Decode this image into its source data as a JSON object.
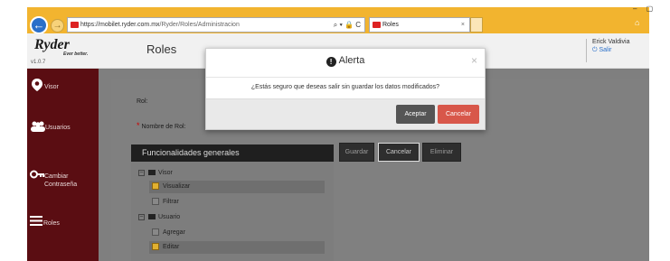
{
  "browser": {
    "url_host": "https://mobilet.ryder.com.mx",
    "url_path": "/Ryder/Roles/Administracion",
    "address_icons": "⌕ ▾ 🔒 C",
    "tab_title": "Roles",
    "tab_close": "×",
    "window_controls": "– ▢"
  },
  "header": {
    "logo": "Ryder",
    "logo_tagline": "Ever better.",
    "version": "v1.0.7",
    "page_title": "Roles",
    "user_name": "Erick Valdivia",
    "logout_label": "Salir"
  },
  "sidebar": {
    "items": [
      {
        "label": "Visor",
        "icon": "map-pin-icon"
      },
      {
        "label": "Usuarios",
        "icon": "users-icon"
      },
      {
        "label": "Cambiar Contraseña",
        "icon": "key-icon"
      },
      {
        "label": "Roles",
        "icon": "list-icon"
      }
    ]
  },
  "form": {
    "rol_label": "Rol:",
    "required_marker": "*",
    "nombre_label": "Nombre de Rol:"
  },
  "functionalities": {
    "heading": "Funcionalidades generales",
    "tree": [
      {
        "label": "Visor",
        "type": "group",
        "expanded": true
      },
      {
        "label": "Visualizar",
        "type": "item",
        "checked": true
      },
      {
        "label": "Filtrar",
        "type": "item",
        "checked": false
      },
      {
        "label": "Usuario",
        "type": "group",
        "expanded": true
      },
      {
        "label": "Agregar",
        "type": "item",
        "checked": false
      },
      {
        "label": "Editar",
        "type": "item",
        "checked": true
      }
    ]
  },
  "actions": {
    "save": "Guardar",
    "cancel": "Cancelar",
    "delete": "Eliminar"
  },
  "modal": {
    "title": "Alerta",
    "message": "¿Estás seguro que deseas salir sin guardar los datos modificados?",
    "accept": "Aceptar",
    "cancel": "Cancelar",
    "close": "×"
  },
  "colors": {
    "chrome": "#f2b42f",
    "sidebar": "#5a0d12",
    "accept_button": "#555555",
    "cancel_button": "#d8574a",
    "checked": "#e0b030"
  }
}
